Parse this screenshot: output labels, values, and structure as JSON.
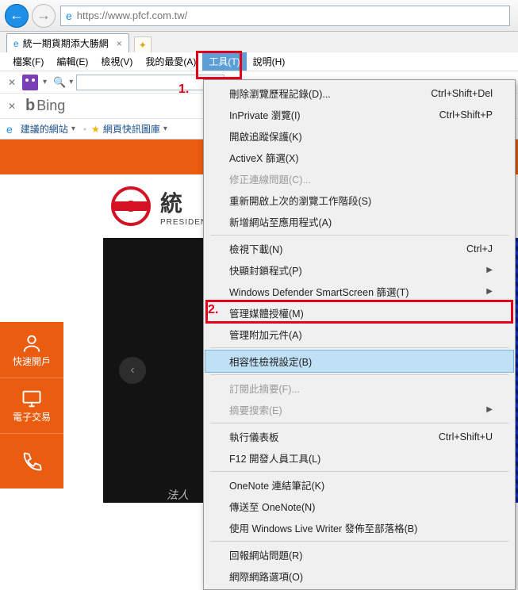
{
  "nav": {
    "url_display": "https://www.pfcf.com.tw/"
  },
  "tab": {
    "title": "統一期貨期添大勝網"
  },
  "menubar": {
    "file": "檔案(F)",
    "edit": "編輯(E)",
    "view": "檢視(V)",
    "fav": "我的最愛(A)",
    "tools": "工具(T)",
    "help": "說明(H)"
  },
  "favlinks": {
    "suggested": "建議的網站",
    "gallery": "網頁快訊圖庫"
  },
  "bing": {
    "b": "b",
    "rest": "Bing"
  },
  "logo": {
    "big": "統",
    "small": "PRESIDEN"
  },
  "sidebar": {
    "item1": "快速開戶",
    "item2": "電子交易"
  },
  "dark_caption": "法人",
  "annotations": {
    "one": "1.",
    "two": "2."
  },
  "dropdown": {
    "del_history": {
      "label": "刪除瀏覽歷程記錄(D)...",
      "shortcut": "Ctrl+Shift+Del"
    },
    "inprivate": {
      "label": "InPrivate 瀏覽(I)",
      "shortcut": "Ctrl+Shift+P"
    },
    "tracking": {
      "label": "開啟追蹤保護(K)",
      "shortcut": ""
    },
    "activex": {
      "label": "ActiveX 篩選(X)",
      "shortcut": ""
    },
    "fix_conn": {
      "label": "修正連線問題(C)...",
      "shortcut": ""
    },
    "reopen": {
      "label": "重新開啟上次的瀏覽工作階段(S)",
      "shortcut": ""
    },
    "add_site": {
      "label": "新增網站至應用程式(A)",
      "shortcut": ""
    },
    "view_dl": {
      "label": "檢視下載(N)",
      "shortcut": "Ctrl+J"
    },
    "popup": {
      "label": "快顯封鎖程式(P)",
      "shortcut": ""
    },
    "defender": {
      "label": "Windows Defender SmartScreen 篩選(T)",
      "shortcut": ""
    },
    "media": {
      "label": "管理媒體授權(M)",
      "shortcut": ""
    },
    "addons": {
      "label": "管理附加元件(A)",
      "shortcut": ""
    },
    "compat": {
      "label": "相容性檢視設定(B)",
      "shortcut": ""
    },
    "subscribe": {
      "label": "訂閱此摘要(F)...",
      "shortcut": ""
    },
    "feed": {
      "label": "摘要搜索(E)",
      "shortcut": ""
    },
    "perf": {
      "label": "執行儀表板",
      "shortcut": "Ctrl+Shift+U"
    },
    "f12": {
      "label": "F12 開發人員工具(L)",
      "shortcut": ""
    },
    "onenote": {
      "label": "OneNote 連結筆記(K)",
      "shortcut": ""
    },
    "sendnote": {
      "label": "傳送至 OneNote(N)",
      "shortcut": ""
    },
    "livewriter": {
      "label": "使用 Windows Live Writer 發佈至部落格(B)",
      "shortcut": ""
    },
    "report": {
      "label": "回報網站問題(R)",
      "shortcut": ""
    },
    "options": {
      "label": "網際網路選項(O)",
      "shortcut": ""
    }
  }
}
